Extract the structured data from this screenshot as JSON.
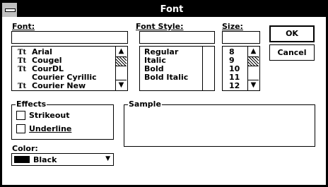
{
  "window": {
    "title": "Font"
  },
  "font": {
    "label": "Font:",
    "value": "",
    "items": [
      "Arial",
      "Cougel",
      "CourDL",
      "Courier Cyrillic",
      "Courier New"
    ],
    "truetype": [
      true,
      true,
      true,
      false,
      true
    ]
  },
  "style": {
    "label": "Font Style:",
    "value": "",
    "items": [
      "Regular",
      "Italic",
      "Bold",
      "Bold Italic"
    ]
  },
  "size": {
    "label": "Size:",
    "value": "",
    "items": [
      "8",
      "9",
      "10",
      "11",
      "12"
    ]
  },
  "buttons": {
    "ok": "OK",
    "cancel": "Cancel"
  },
  "effects": {
    "label": "Effects",
    "strikeout": "Strikeout",
    "underline": "Underline"
  },
  "sample": {
    "label": "Sample"
  },
  "color": {
    "label": "Color:",
    "value": "Black",
    "swatch": "#000000"
  },
  "icons": {
    "truetype": "Tt",
    "scroll_up": "▲",
    "scroll_down": "▼",
    "dropdown": "▼"
  }
}
